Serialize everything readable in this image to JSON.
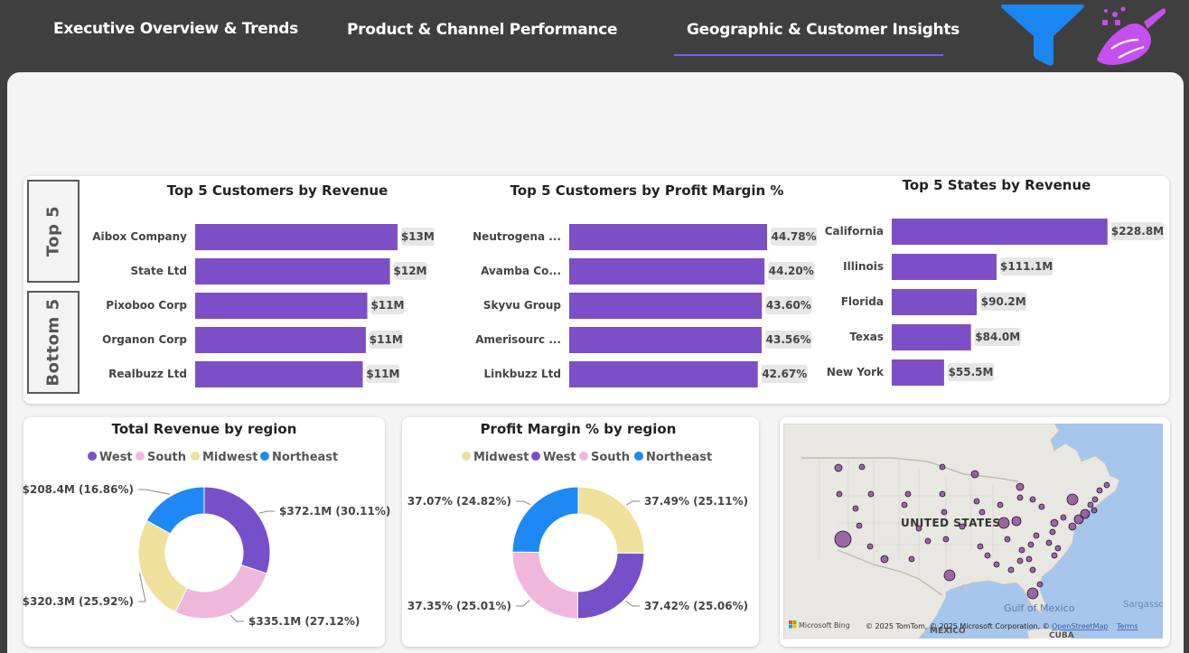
{
  "nav": {
    "tabs": [
      {
        "label": "Executive Overview & Trends"
      },
      {
        "label": "Product & Channel Performance"
      },
      {
        "label": "Geographic & Customer Insights"
      }
    ],
    "active_tab": "Geographic & Customer Insights"
  },
  "icons": {
    "filter": "filter-funnel-icon",
    "clear": "clear-filters-broom-icon"
  },
  "colors": {
    "accent": "#7d4fc6",
    "west": "#7650c9",
    "south": "#f0b7dd",
    "midwest": "#efe09c",
    "northeast": "#1e88f5",
    "nav_bg": "#3f3f3f"
  },
  "toggle": {
    "top": "Top 5",
    "bottom": "Bottom 5"
  },
  "chart_data": [
    {
      "type": "bar",
      "title": "Top 5 Customers by Revenue",
      "categories": [
        "Aibox Company",
        "State Ltd",
        "Pixoboo Corp",
        "Organon Corp",
        "Realbuzz Ltd"
      ],
      "values": [
        13.4,
        12.9,
        11.4,
        11.3,
        11.1
      ],
      "labels": [
        "$13M",
        "$12M",
        "$11M",
        "$11M",
        "$11M"
      ],
      "xlim": [
        0,
        14
      ]
    },
    {
      "type": "bar",
      "title": "Top 5 Customers by Profit Margin %",
      "categories": [
        "Neutrogena ...",
        "Avamba Co...",
        "Skyvu Group",
        "Amerisourc ...",
        "Linkbuzz Ltd"
      ],
      "values": [
        44.78,
        44.2,
        43.6,
        43.56,
        42.67
      ],
      "labels": [
        "44.78%",
        "44.20%",
        "43.60%",
        "43.56%",
        "42.67%"
      ],
      "xlim": [
        0,
        46
      ]
    },
    {
      "type": "bar",
      "title": "Top 5 States by Revenue",
      "categories": [
        "California",
        "Illinois",
        "Florida",
        "Texas",
        "New York"
      ],
      "values": [
        228.8,
        111.1,
        90.2,
        84.0,
        55.5
      ],
      "labels": [
        "$228.8M",
        "$111.1M",
        "$90.2M",
        "$84.0M",
        "$55.5M"
      ],
      "xlim": [
        0,
        229
      ]
    },
    {
      "type": "pie",
      "title": "Total Revenue by region",
      "legend": [
        "West",
        "South",
        "Midwest",
        "Northeast"
      ],
      "slices": [
        {
          "name": "West",
          "value": 30.11,
          "label": "$372.1M (30.11%)",
          "color": "#7650c9"
        },
        {
          "name": "South",
          "value": 27.12,
          "label": "$335.1M (27.12%)",
          "color": "#f0b7dd"
        },
        {
          "name": "Midwest",
          "value": 25.92,
          "label": "$320.3M (25.92%)",
          "color": "#efe09c"
        },
        {
          "name": "Northeast",
          "value": 16.86,
          "label": "$208.4M (16.86%)",
          "color": "#1e88f5"
        }
      ]
    },
    {
      "type": "pie",
      "title": "Profit Margin % by region",
      "legend": [
        "Midwest",
        "West",
        "South",
        "Northeast"
      ],
      "slices": [
        {
          "name": "Midwest",
          "value": 25.11,
          "label": "37.49% (25.11%)",
          "color": "#efe09c"
        },
        {
          "name": "West",
          "value": 25.06,
          "label": "37.42% (25.06%)",
          "color": "#7650c9"
        },
        {
          "name": "South",
          "value": 25.01,
          "label": "37.35% (25.01%)",
          "color": "#f0b7dd"
        },
        {
          "name": "Northeast",
          "value": 24.82,
          "label": "37.07% (24.82%)",
          "color": "#1e88f5"
        }
      ]
    }
  ],
  "map": {
    "country_label": "UNITED STATES",
    "gulf_label": "Gulf of Mexico",
    "mexico_label": "MEXICO",
    "cuba_label": "CUBA",
    "sargasso_label": "Sargasso",
    "bing_logo": "Microsoft Bing",
    "copyright": "© 2025 TomTom, © 2025 Microsoft Corporation, ©",
    "osm_link": "OpenStreetMap",
    "terms_link": "Terms",
    "bubble_color": "#7d3c8c"
  }
}
